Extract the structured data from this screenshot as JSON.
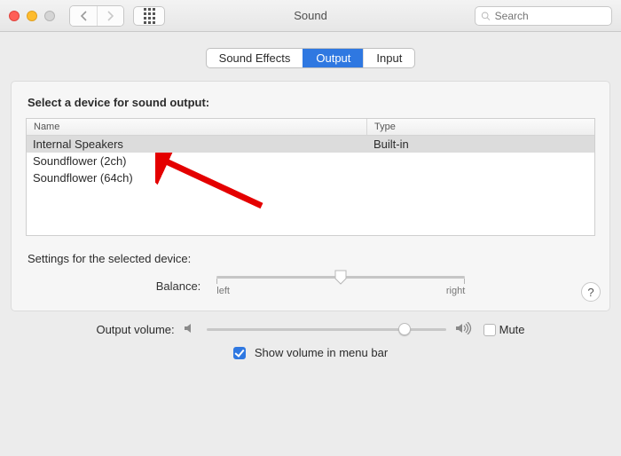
{
  "window": {
    "title": "Sound"
  },
  "search": {
    "placeholder": "Search"
  },
  "tabs": [
    {
      "label": "Sound Effects",
      "active": false
    },
    {
      "label": "Output",
      "active": true
    },
    {
      "label": "Input",
      "active": false
    }
  ],
  "output_panel": {
    "heading": "Select a device for sound output:",
    "columns": {
      "name": "Name",
      "type": "Type"
    },
    "devices": [
      {
        "name": "Internal Speakers",
        "type": "Built-in",
        "selected": true
      },
      {
        "name": "Soundflower (2ch)",
        "type": "",
        "selected": false
      },
      {
        "name": "Soundflower (64ch)",
        "type": "",
        "selected": false
      }
    ],
    "settings_label": "Settings for the selected device:",
    "balance": {
      "label": "Balance:",
      "left_label": "left",
      "right_label": "right",
      "value_percent": 50
    }
  },
  "footer": {
    "volume_label": "Output volume:",
    "volume_percent": 80,
    "mute": {
      "label": "Mute",
      "checked": false
    },
    "show_in_menu_bar": {
      "label": "Show volume in menu bar",
      "checked": true
    }
  },
  "help_tooltip": "?",
  "annotation": {
    "arrow_target": "Soundflower (2ch)",
    "color": "#e40000"
  }
}
